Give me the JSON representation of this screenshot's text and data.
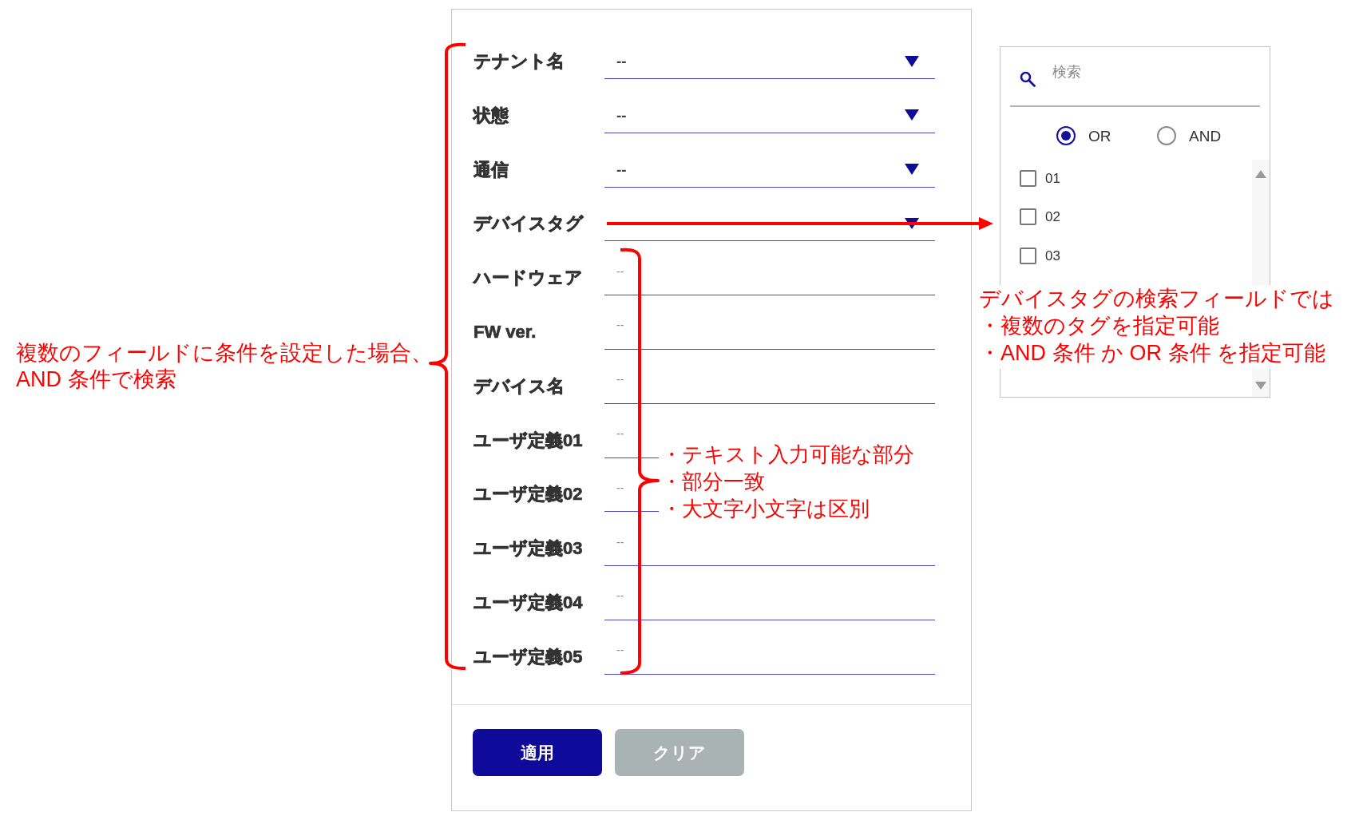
{
  "filter_panel": {
    "fields": [
      {
        "label": "テナント名",
        "kind": "select",
        "value": "--"
      },
      {
        "label": "状態",
        "kind": "select",
        "value": "--"
      },
      {
        "label": "通信",
        "kind": "select",
        "value": "--"
      },
      {
        "label": "デバイスタグ",
        "kind": "select"
      },
      {
        "label": "ハードウェア",
        "kind": "text",
        "placeholder": "--"
      },
      {
        "label": "FW ver.",
        "kind": "text",
        "placeholder": "--"
      },
      {
        "label": "デバイス名",
        "kind": "text",
        "placeholder": "--"
      },
      {
        "label": "ユーザ定義01",
        "kind": "text",
        "placeholder": "--"
      },
      {
        "label": "ユーザ定義02",
        "kind": "text",
        "placeholder": "--"
      },
      {
        "label": "ユーザ定義03",
        "kind": "text",
        "placeholder": "--"
      },
      {
        "label": "ユーザ定義04",
        "kind": "text",
        "placeholder": "--"
      },
      {
        "label": "ユーザ定義05",
        "kind": "text",
        "placeholder": "--"
      }
    ],
    "buttons": [
      {
        "label": "適用",
        "disabled": false
      },
      {
        "label": "クリア",
        "disabled": true
      }
    ]
  },
  "tag_dropdown": {
    "search": {
      "placeholder": "検索"
    },
    "match_modes": [
      {
        "label": "OR",
        "selected": true
      },
      {
        "label": "AND",
        "selected": false
      }
    ],
    "tags": [
      {
        "label": "01",
        "checked": false
      },
      {
        "label": "02",
        "checked": false
      },
      {
        "label": "03",
        "checked": false
      }
    ]
  },
  "annotations": {
    "conditions_note": {
      "lines": [
        "複数のフィールドに条件を設定した場合、",
        "AND 条件で検索"
      ]
    },
    "text_fields_note": {
      "items": [
        "・テキスト入力可能な部分",
        "・部分一致",
        "・大文字小文字は区別"
      ]
    },
    "device_tag_note": {
      "title": "デバイスタグの検索フィールドでは",
      "items": [
        "・複数のタグを指定可能",
        "・AND 条件 か OR 条件 を指定可能"
      ]
    }
  }
}
